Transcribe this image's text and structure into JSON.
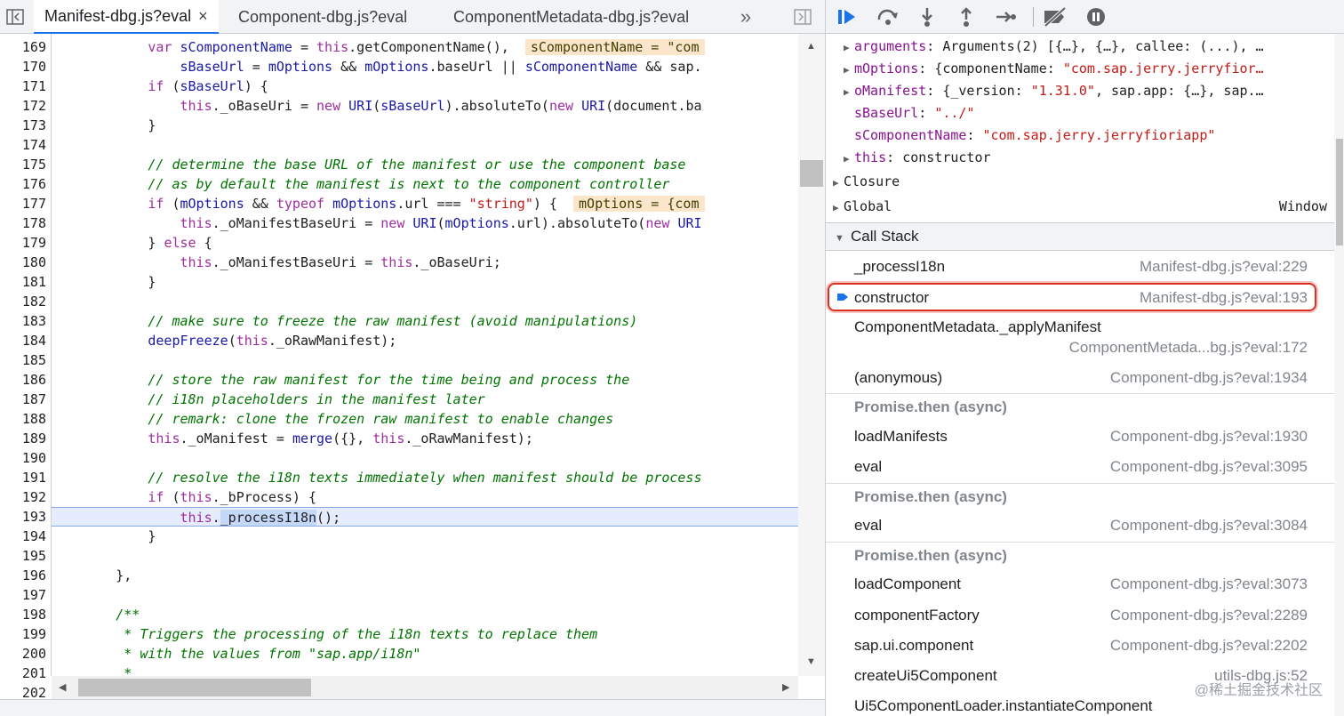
{
  "tabs": [
    {
      "label": "Manifest-dbg.js?eval",
      "active": true
    },
    {
      "label": "Component-dbg.js?eval",
      "active": false
    },
    {
      "label": "ComponentMetadata-dbg.js?eval",
      "active": false
    }
  ],
  "tab_close": "×",
  "tab_overflow": "»",
  "line_numbers": [
    "169",
    "170",
    "171",
    "172",
    "173",
    "174",
    "175",
    "176",
    "177",
    "178",
    "179",
    "180",
    "181",
    "182",
    "183",
    "184",
    "185",
    "186",
    "187",
    "188",
    "189",
    "190",
    "191",
    "192",
    "193",
    "194",
    "195",
    "196",
    "197",
    "198",
    "199",
    "200",
    "201",
    "202"
  ],
  "inline_values": {
    "line169": "sComponentName = \"com",
    "line177": "mOptions = {com"
  },
  "scope": {
    "items": [
      {
        "key": "arguments",
        "value": "Arguments(2) [{…}, {…}, callee: (...), …",
        "expandable": true
      },
      {
        "key": "mOptions",
        "value": "{componentName: ",
        "value_str": "\"com.sap.jerry.jerryfior…",
        "expandable": true
      },
      {
        "key": "oManifest",
        "value": "{_version: ",
        "value_str": "\"1.31.0\"",
        "value_tail": ", sap.app: {…}, sap.…",
        "expandable": true
      },
      {
        "key": "sBaseUrl",
        "value": "",
        "value_str": "\"../\"",
        "expandable": false
      },
      {
        "key": "sComponentName",
        "value": "",
        "value_str": "\"com.sap.jerry.jerryfioriapp\"",
        "expandable": false
      },
      {
        "key": "this",
        "value": "constructor",
        "expandable": true
      }
    ],
    "closure_label": "Closure",
    "global_label": "Global",
    "global_value": "Window"
  },
  "call_stack": {
    "title": "Call Stack",
    "frames": [
      {
        "name": "_processI18n",
        "location": "Manifest-dbg.js?eval:229"
      },
      {
        "name": "constructor",
        "location": "Manifest-dbg.js?eval:193",
        "selected": true
      },
      {
        "name": "ComponentMetadata._applyManifest",
        "location": "ComponentMetada...bg.js?eval:172"
      },
      {
        "name": "(anonymous)",
        "location": "Component-dbg.js?eval:1934"
      },
      {
        "async": "Promise.then (async)"
      },
      {
        "name": "loadManifests",
        "location": "Component-dbg.js?eval:1930"
      },
      {
        "name": "eval",
        "location": "Component-dbg.js?eval:3095"
      },
      {
        "async": "Promise.then (async)"
      },
      {
        "name": "eval",
        "location": "Component-dbg.js?eval:3084"
      },
      {
        "async": "Promise.then (async)"
      },
      {
        "name": "loadComponent",
        "location": "Component-dbg.js?eval:3073"
      },
      {
        "name": "componentFactory",
        "location": "Component-dbg.js?eval:2289"
      },
      {
        "name": "sap.ui.component",
        "location": "Component-dbg.js?eval:2202"
      },
      {
        "name": "createUi5Component",
        "location": "utils-dbg.js:52"
      },
      {
        "name": "Ui5ComponentLoader.instantiateComponent",
        "location": ""
      }
    ]
  },
  "watermark": "@稀土掘金技术社区",
  "accent_color": "#1a73e8",
  "highlight_color": "#d93025"
}
